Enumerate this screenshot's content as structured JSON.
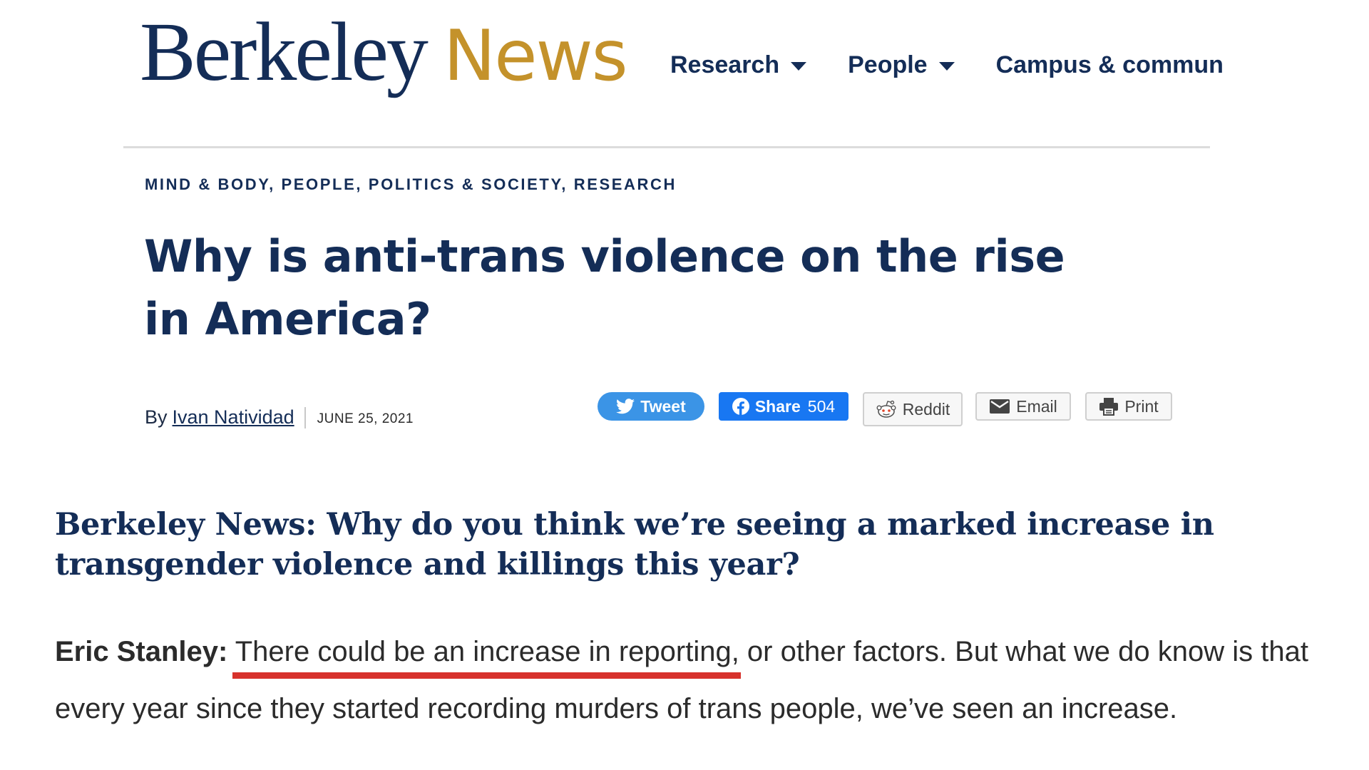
{
  "header": {
    "logo_berkeley": "Berkeley",
    "logo_news": "News",
    "nav": [
      {
        "label": "Research",
        "has_dropdown": true
      },
      {
        "label": "People",
        "has_dropdown": true
      },
      {
        "label": "Campus & commun",
        "has_dropdown": false
      }
    ]
  },
  "article": {
    "categories": [
      "MIND & BODY",
      "PEOPLE",
      "POLITICS & SOCIETY",
      "RESEARCH"
    ],
    "category_separator": ",",
    "title": "Why is anti-trans violence on the rise in America?",
    "byline_prefix": "By",
    "author": "Ivan Natividad",
    "date": "JUNE 25, 2021"
  },
  "share": {
    "tweet_label": "Tweet",
    "facebook_label": "Share",
    "facebook_count": "504",
    "reddit_label": "Reddit",
    "email_label": "Email",
    "print_label": "Print",
    "icons": [
      "twitter-icon",
      "facebook-icon",
      "reddit-icon",
      "email-icon",
      "print-icon"
    ]
  },
  "body": {
    "question": "Berkeley News: Why do you think we’re seeing a marked increase in transgender violence and killings this year?",
    "answer_speaker": "Eric Stanley:",
    "answer_highlighted": "There could be an increase in reporting,",
    "answer_rest": " or other factors. But what we do know is that every year since they started recording murders of trans people, we’ve seen an increase."
  },
  "colors": {
    "navy": "#142d57",
    "gold": "#c4922b",
    "twitter_blue": "#3b94e6",
    "facebook_blue": "#1877f2",
    "highlight_red": "#d7322c"
  }
}
